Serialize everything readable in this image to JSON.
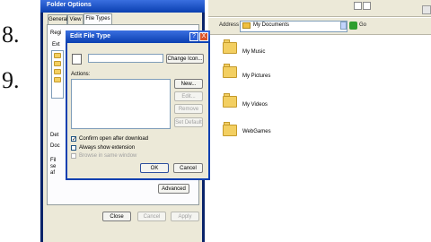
{
  "side_numbers": {
    "first": "8.",
    "second": "9."
  },
  "side_bracket": "[",
  "explorer": {
    "address_label": "Address",
    "address_value": "My Documents",
    "go_label": "Go",
    "folders": [
      {
        "label": "My Music"
      },
      {
        "label": "My Pictures"
      },
      {
        "label": "My Videos"
      },
      {
        "label": "WebGames"
      }
    ]
  },
  "folder_options": {
    "title": "Folder Options",
    "tabs": [
      {
        "label": "General"
      },
      {
        "label": "View"
      },
      {
        "label": "File Types"
      }
    ],
    "fragments": {
      "reg": "Regi",
      "ext": "Ext",
      "det": "Det",
      "doc": "Doc",
      "fil": "Fil",
      "se": "se",
      "af": "af"
    },
    "advanced_label": "Advanced",
    "buttons": {
      "close": "Close",
      "cancel": "Cancel",
      "apply": "Apply"
    }
  },
  "edit_file_type": {
    "title": "Edit File Type",
    "help_glyph": "?",
    "close_glyph": "X",
    "type_input_value": "",
    "change_icon_label": "Change Icon...",
    "actions_label": "Actions:",
    "side_buttons": {
      "new": "New...",
      "edit": "Edit...",
      "remove": "Remove",
      "set_default": "Set Default"
    },
    "checkboxes": [
      {
        "label": "Confirm open after download",
        "checked": true,
        "enabled": true
      },
      {
        "label": "Always show extension",
        "checked": false,
        "enabled": true
      },
      {
        "label": "Browse in same window",
        "checked": false,
        "enabled": false
      }
    ],
    "ok_label": "OK",
    "cancel_label": "Cancel"
  }
}
